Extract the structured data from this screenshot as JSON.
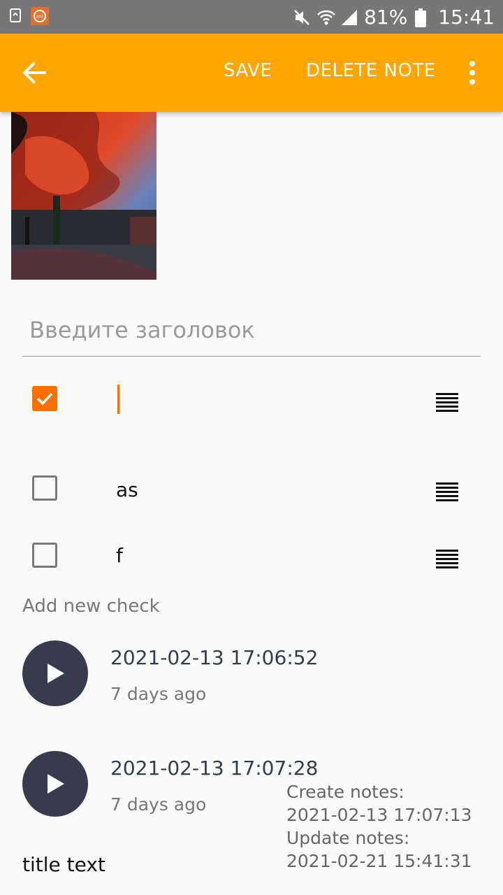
{
  "status_bar": {
    "battery_percent": "81%",
    "time": "15:41",
    "icons": [
      "recycle-icon",
      "mi-app-icon",
      "mute-icon",
      "wifi-icon",
      "signal-icon",
      "battery-icon"
    ]
  },
  "app_bar": {
    "back_icon": "arrow-left-icon",
    "save_label": "SAVE",
    "delete_label": "DELETE NOTE",
    "overflow_icon": "more-vert-icon",
    "background_color": "#ffa500"
  },
  "image": {
    "description_icon": "photo-thumbnail"
  },
  "title_field": {
    "placeholder": "Введите заголовок",
    "value": ""
  },
  "checklist": {
    "items": [
      {
        "checked": true,
        "text": ""
      },
      {
        "checked": false,
        "text": "as"
      },
      {
        "checked": false,
        "text": "f"
      }
    ],
    "add_label": "Add new check",
    "accent_color": "#ff6f00"
  },
  "audio_notes": [
    {
      "date": "2021-02-13 17:06:52",
      "age": "7 days ago"
    },
    {
      "date": "2021-02-13 17:07:28",
      "age": "7 days ago"
    }
  ],
  "note_meta": {
    "create_label": "Create notes:",
    "create_value": "2021-02-13 17:07:13",
    "update_label": "Update notes:",
    "update_value": "2021-02-21 15:41:31"
  },
  "footer_title": "title text"
}
